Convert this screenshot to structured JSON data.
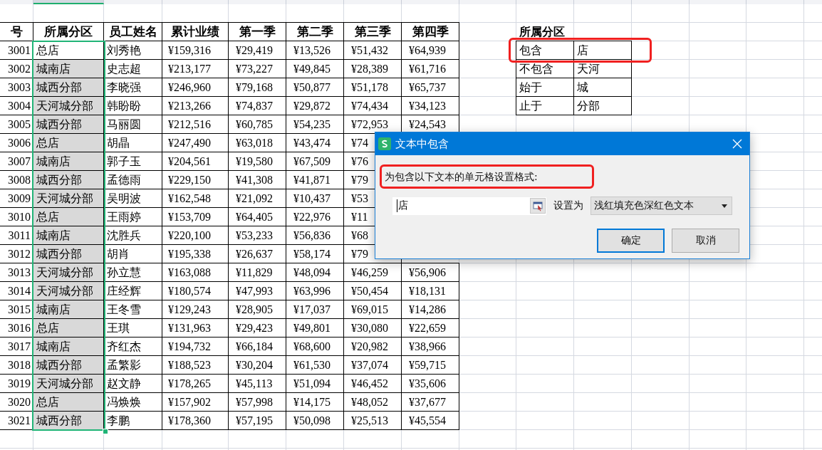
{
  "column_strip": [
    {
      "selected": false
    },
    {
      "selected": true
    },
    {
      "selected": false
    },
    {
      "selected": false
    },
    {
      "selected": false
    },
    {
      "selected": false
    },
    {
      "selected": false
    },
    {
      "selected": false
    },
    {
      "selected": false
    },
    {
      "selected": false
    },
    {
      "selected": false
    },
    {
      "selected": false
    },
    {
      "selected": false
    },
    {
      "selected": false
    },
    {
      "selected": false
    }
  ],
  "table": {
    "columns": [
      "号",
      "所属分区",
      "员工姓名",
      "累计业绩",
      "第一季",
      "第二季",
      "第三季",
      "第四季"
    ],
    "rows": [
      {
        "cells": [
          "3001",
          "总店",
          "刘秀艳",
          "¥159,316",
          "¥29,419",
          "¥13,526",
          "¥51,432",
          "¥64,939"
        ],
        "highlighted": false
      },
      {
        "cells": [
          "3002",
          "城南店",
          "史志超",
          "¥213,177",
          "¥73,227",
          "¥49,845",
          "¥28,389",
          "¥61,716"
        ],
        "highlighted": true
      },
      {
        "cells": [
          "3003",
          "城西分部",
          "李晓强",
          "¥246,960",
          "¥79,168",
          "¥50,877",
          "¥51,178",
          "¥65,737"
        ],
        "highlighted": true
      },
      {
        "cells": [
          "3004",
          "天河城分部",
          "韩盼盼",
          "¥213,266",
          "¥74,837",
          "¥29,872",
          "¥74,434",
          "¥34,123"
        ],
        "highlighted": true
      },
      {
        "cells": [
          "3005",
          "城西分部",
          "马丽圆",
          "¥212,516",
          "¥60,785",
          "¥54,235",
          "¥72,953",
          "¥24,543"
        ],
        "highlighted": true
      },
      {
        "cells": [
          "3006",
          "总店",
          "胡晶",
          "¥247,490",
          "¥63,018",
          "¥43,474",
          "¥74"
        ],
        "highlighted": true
      },
      {
        "cells": [
          "3007",
          "城南店",
          "郭子玉",
          "¥204,561",
          "¥19,580",
          "¥67,509",
          "¥76"
        ],
        "highlighted": true
      },
      {
        "cells": [
          "3008",
          "城西分部",
          "孟德雨",
          "¥229,150",
          "¥41,308",
          "¥41,871",
          "¥79"
        ],
        "highlighted": true
      },
      {
        "cells": [
          "3009",
          "天河城分部",
          "吴明波",
          "¥162,548",
          "¥21,092",
          "¥10,437",
          "¥53"
        ],
        "highlighted": true
      },
      {
        "cells": [
          "3010",
          "总店",
          "王雨婷",
          "¥153,709",
          "¥64,405",
          "¥22,976",
          "¥11"
        ],
        "highlighted": true
      },
      {
        "cells": [
          "3011",
          "城南店",
          "沈胜兵",
          "¥220,100",
          "¥53,233",
          "¥56,836",
          "¥68"
        ],
        "highlighted": true
      },
      {
        "cells": [
          "3012",
          "城西分部",
          "胡肖",
          "¥195,338",
          "¥26,637",
          "¥58,174",
          "¥79"
        ],
        "highlighted": true
      },
      {
        "cells": [
          "3013",
          "天河城分部",
          "孙立慧",
          "¥163,088",
          "¥11,829",
          "¥48,094",
          "¥46,259",
          "¥56,906"
        ],
        "highlighted": true
      },
      {
        "cells": [
          "3014",
          "天河城分部",
          "庄经辉",
          "¥180,574",
          "¥47,993",
          "¥63,996",
          "¥50,454",
          "¥18,131"
        ],
        "highlighted": true
      },
      {
        "cells": [
          "3015",
          "城南店",
          "王冬雪",
          "¥129,243",
          "¥28,905",
          "¥17,037",
          "¥69,015",
          "¥14,286"
        ],
        "highlighted": true
      },
      {
        "cells": [
          "3016",
          "总店",
          "王琪",
          "¥131,963",
          "¥29,423",
          "¥49,801",
          "¥30,080",
          "¥22,659"
        ],
        "highlighted": true
      },
      {
        "cells": [
          "3017",
          "城南店",
          "齐红杰",
          "¥194,732",
          "¥66,184",
          "¥68,600",
          "¥20,982",
          "¥38,966"
        ],
        "highlighted": true
      },
      {
        "cells": [
          "3018",
          "城西分部",
          "孟繁影",
          "¥188,523",
          "¥30,204",
          "¥61,530",
          "¥37,074",
          "¥59,715"
        ],
        "highlighted": true
      },
      {
        "cells": [
          "3019",
          "天河城分部",
          "赵文静",
          "¥178,265",
          "¥45,113",
          "¥51,094",
          "¥46,452",
          "¥35,606"
        ],
        "highlighted": true
      },
      {
        "cells": [
          "3020",
          "总店",
          "冯焕焕",
          "¥157,902",
          "¥57,998",
          "¥14,175",
          "¥48,052",
          "¥37,677"
        ],
        "highlighted": true
      },
      {
        "cells": [
          "3021",
          "城西分部",
          "李鹏",
          "¥178,360",
          "¥57,195",
          "¥50,098",
          "¥25,513",
          "¥45,554"
        ],
        "highlighted": true
      }
    ]
  },
  "criteria": {
    "title": "所属分区",
    "rows": [
      [
        "包含",
        "店"
      ],
      [
        "不包含",
        "天河"
      ],
      [
        "始于",
        "城"
      ],
      [
        "止于",
        "分部"
      ]
    ]
  },
  "dialog": {
    "title": "文本中包含",
    "prompt": "为包含以下文本的单元格设置格式:",
    "value": "店",
    "format_label": "设置为",
    "format_value": "浅红填充色深红色文本",
    "buttons": [
      {
        "label": "确定",
        "default": true
      },
      {
        "label": "取消",
        "default": false
      }
    ]
  }
}
